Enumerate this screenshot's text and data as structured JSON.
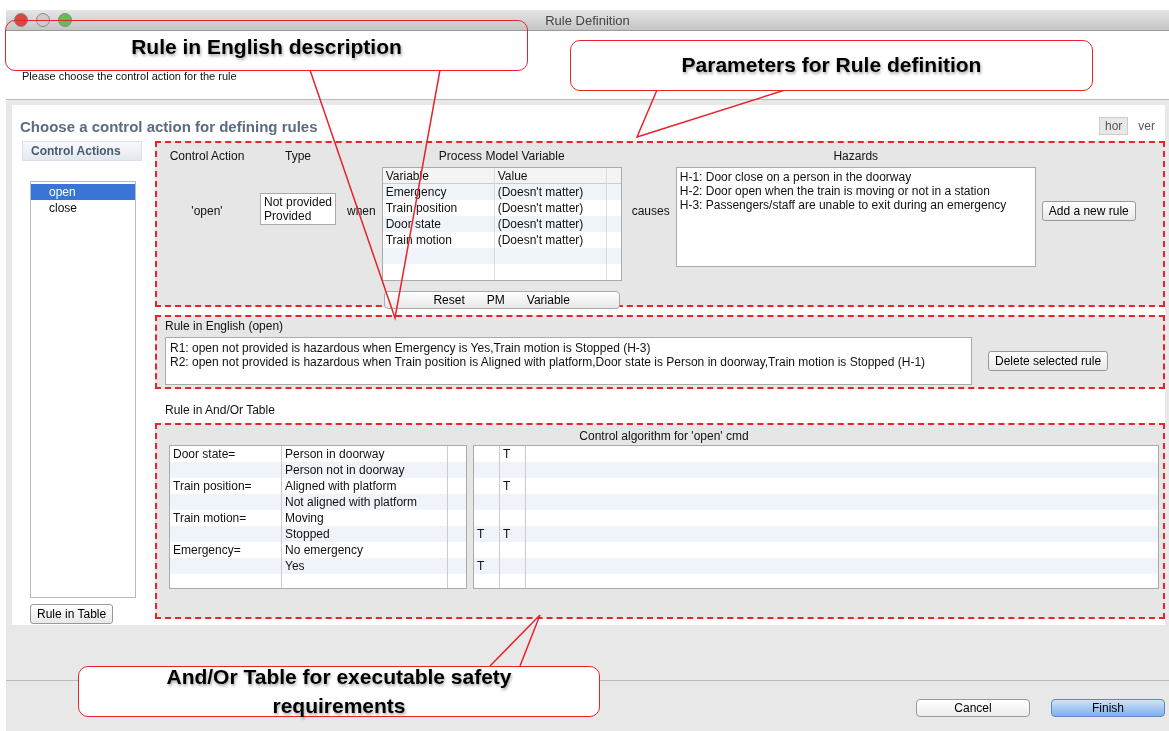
{
  "window": {
    "title": "Rule Definition"
  },
  "header": {
    "instruction": "Please choose the control action for the rule"
  },
  "heading": "Choose a control action for defining rules",
  "layout_toggle": [
    {
      "label": "hor",
      "selected": true
    },
    {
      "label": "ver",
      "selected": false
    }
  ],
  "sidebar": {
    "tab": "Control Actions",
    "items": [
      {
        "label": "open",
        "selected": true
      },
      {
        "label": "close",
        "selected": false
      }
    ],
    "button": "Rule in Table"
  },
  "parameters": {
    "control_action_header": "Control Action",
    "type_header": "Type",
    "pmv_header": "Process Model Variable",
    "hazards_header": "Hazards",
    "control_action": "'open'",
    "types": [
      "Not provided",
      "Provided"
    ],
    "when": "when",
    "pmv_columns": [
      "Variable",
      "Value"
    ],
    "pmv_rows": [
      {
        "variable": "Emergency",
        "value": "(Doesn't matter)"
      },
      {
        "variable": "Train position",
        "value": "(Doesn't matter)"
      },
      {
        "variable": "Door state",
        "value": "(Doesn't matter)"
      },
      {
        "variable": "Train motion",
        "value": "(Doesn't matter)"
      }
    ],
    "reset_button": [
      "Reset",
      "PM",
      "Variable"
    ],
    "causes": "causes",
    "hazards": [
      "H-1: Door close on a person in the doorway",
      "H-2: Door open when the train is moving or not in a station",
      "H-3: Passengers/staff are unable to exit during an emergency"
    ],
    "add_button": "Add a new rule"
  },
  "rule_english": {
    "title": "Rule in English (open)",
    "rules": [
      "R1: open not provided is hazardous when Emergency is Yes,Train motion is Stopped (H-3)",
      "R2: open not provided is hazardous when Train position is Aligned with platform,Door state is Person in doorway,Train motion is Stopped (H-1)"
    ],
    "delete_button": "Delete selected rule"
  },
  "table_label": "Rule in And/Or Table",
  "andor": {
    "title": "Control algorithm for 'open' cmd",
    "rows": [
      {
        "variable": "Door state=",
        "value": "Person in doorway",
        "rule_2": "T"
      },
      {
        "value": "Person not in doorway"
      },
      {
        "variable": "Train position=",
        "value": "Aligned with platform",
        "rule_2": "T"
      },
      {
        "value": "Not aligned with platform"
      },
      {
        "variable": "Train motion=",
        "value": "Moving"
      },
      {
        "value": "Stopped",
        "rule_1": "T",
        "rule_2": "T"
      },
      {
        "variable": "Emergency=",
        "value": "No emergency"
      },
      {
        "value": "Yes",
        "rule_1": "T"
      }
    ]
  },
  "footer": {
    "buttons": [
      {
        "label": "Cancel",
        "primary": false
      },
      {
        "label": "Finish",
        "primary": true
      }
    ]
  },
  "annotations": [
    {
      "kind": "english",
      "text": "Rule in English description"
    },
    {
      "kind": "parameters",
      "text": "Parameters for Rule definition"
    },
    {
      "kind": "table",
      "text": "And/Or Table for executable safety requirements"
    }
  ]
}
